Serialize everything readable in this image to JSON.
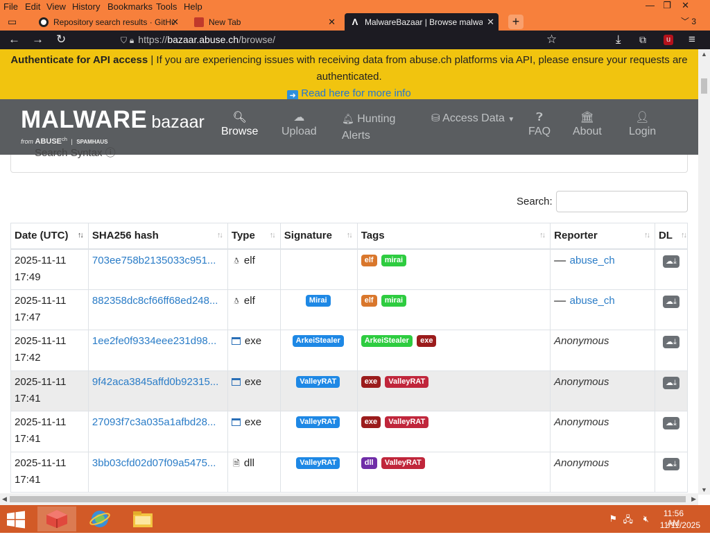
{
  "browser": {
    "menu": [
      "File",
      "Edit",
      "View",
      "History",
      "Bookmarks",
      "Tools",
      "Help"
    ],
    "tabs": [
      {
        "label": "Repository search results · GitHub",
        "icon": "github-icon"
      },
      {
        "label": "New Tab",
        "icon": "new-tab-icon"
      },
      {
        "label": "MalwareBazaar | Browse malware",
        "icon": "malwarebazaar-icon",
        "active": true
      }
    ],
    "tab_count": "3",
    "url": {
      "scheme": "https://",
      "host": "bazaar.abuse.ch",
      "path": "/browse/"
    }
  },
  "banner": {
    "bold": "Authenticate for API access",
    "text": " | If you are experiencing issues with receiving data from abuse.ch platforms via API, please ensure your requests are authenticated.",
    "link": "Read here for more info"
  },
  "site": {
    "brand_main": "MALWARE",
    "brand_sub": "bazaar",
    "brand_from": "from",
    "brand_abuse": "ABUSE",
    "brand_ch": "ch",
    "brand_spamhaus": "SPAMHAUS",
    "nav": [
      {
        "label": "Browse",
        "icon": "search-icon",
        "active": true
      },
      {
        "label": "Upload",
        "icon": "cloud-upload-icon"
      },
      {
        "label": "Hunting Alerts",
        "icon": "bell-icon"
      },
      {
        "label": "Access Data",
        "icon": "database-icon"
      },
      {
        "label": "FAQ",
        "icon": "question-icon"
      },
      {
        "label": "About",
        "icon": "building-icon"
      },
      {
        "label": "Login",
        "icon": "user-icon"
      }
    ],
    "search_syntax": "Search Syntax"
  },
  "search": {
    "label": "Search:",
    "value": ""
  },
  "table": {
    "columns": [
      "Date (UTC)",
      "SHA256 hash",
      "Type",
      "Signature",
      "Tags",
      "Reporter",
      "DL"
    ],
    "rows": [
      {
        "date": "2025-11-11",
        "time": "17:49",
        "hash": "703ee758b2135033c951...",
        "type": "elf",
        "type_icon": "linux-icon",
        "signature": "",
        "tags": [
          {
            "label": "elf",
            "color": "#d9772c"
          },
          {
            "label": "mirai",
            "color": "#2ecc40"
          }
        ],
        "reporter": "abuse_ch",
        "reporter_link": true
      },
      {
        "date": "2025-11-11",
        "time": "17:47",
        "hash": "882358dc8cf66ff68ed248...",
        "type": "elf",
        "type_icon": "linux-icon",
        "signature": "Mirai",
        "tags": [
          {
            "label": "elf",
            "color": "#d9772c"
          },
          {
            "label": "mirai",
            "color": "#2ecc40"
          }
        ],
        "reporter": "abuse_ch",
        "reporter_link": true
      },
      {
        "date": "2025-11-11",
        "time": "17:42",
        "hash": "1ee2fe0f9334eee231d98...",
        "type": "exe",
        "type_icon": "windows-icon",
        "signature": "ArkeiStealer",
        "tags": [
          {
            "label": "ArkeiStealer",
            "color": "#2ecc40"
          },
          {
            "label": "exe",
            "color": "#9b1c1c"
          }
        ],
        "reporter": "Anonymous",
        "reporter_link": false
      },
      {
        "date": "2025-11-11",
        "time": "17:41",
        "hash": "9f42aca3845affd0b92315...",
        "type": "exe",
        "type_icon": "windows-icon",
        "signature": "ValleyRAT",
        "tags": [
          {
            "label": "exe",
            "color": "#9b1c1c"
          },
          {
            "label": "ValleyRAT",
            "color": "#c0263b"
          }
        ],
        "reporter": "Anonymous",
        "reporter_link": false
      },
      {
        "date": "2025-11-11",
        "time": "17:41",
        "hash": "27093f7c3a035a1afbd28...",
        "type": "exe",
        "type_icon": "windows-icon",
        "signature": "ValleyRAT",
        "tags": [
          {
            "label": "exe",
            "color": "#9b1c1c"
          },
          {
            "label": "ValleyRAT",
            "color": "#c0263b"
          }
        ],
        "reporter": "Anonymous",
        "reporter_link": false
      },
      {
        "date": "2025-11-11",
        "time": "17:41",
        "hash": "3bb03cfd02d07f09a5475...",
        "type": "dll",
        "type_icon": "dll-file-icon",
        "signature": "ValleyRAT",
        "tags": [
          {
            "label": "dll",
            "color": "#6f2da8"
          },
          {
            "label": "ValleyRAT",
            "color": "#c0263b"
          }
        ],
        "reporter": "Anonymous",
        "reporter_link": false
      }
    ]
  },
  "colors": {
    "signature_badge": "#1e88e5",
    "banner": "#f1c40f",
    "site_nav": "#5a5d60",
    "taskbar": "#d25a27",
    "browser_chrome": "#f7803c"
  },
  "taskbar": {
    "time": "11:56 AM",
    "date": "11/11/2025"
  }
}
